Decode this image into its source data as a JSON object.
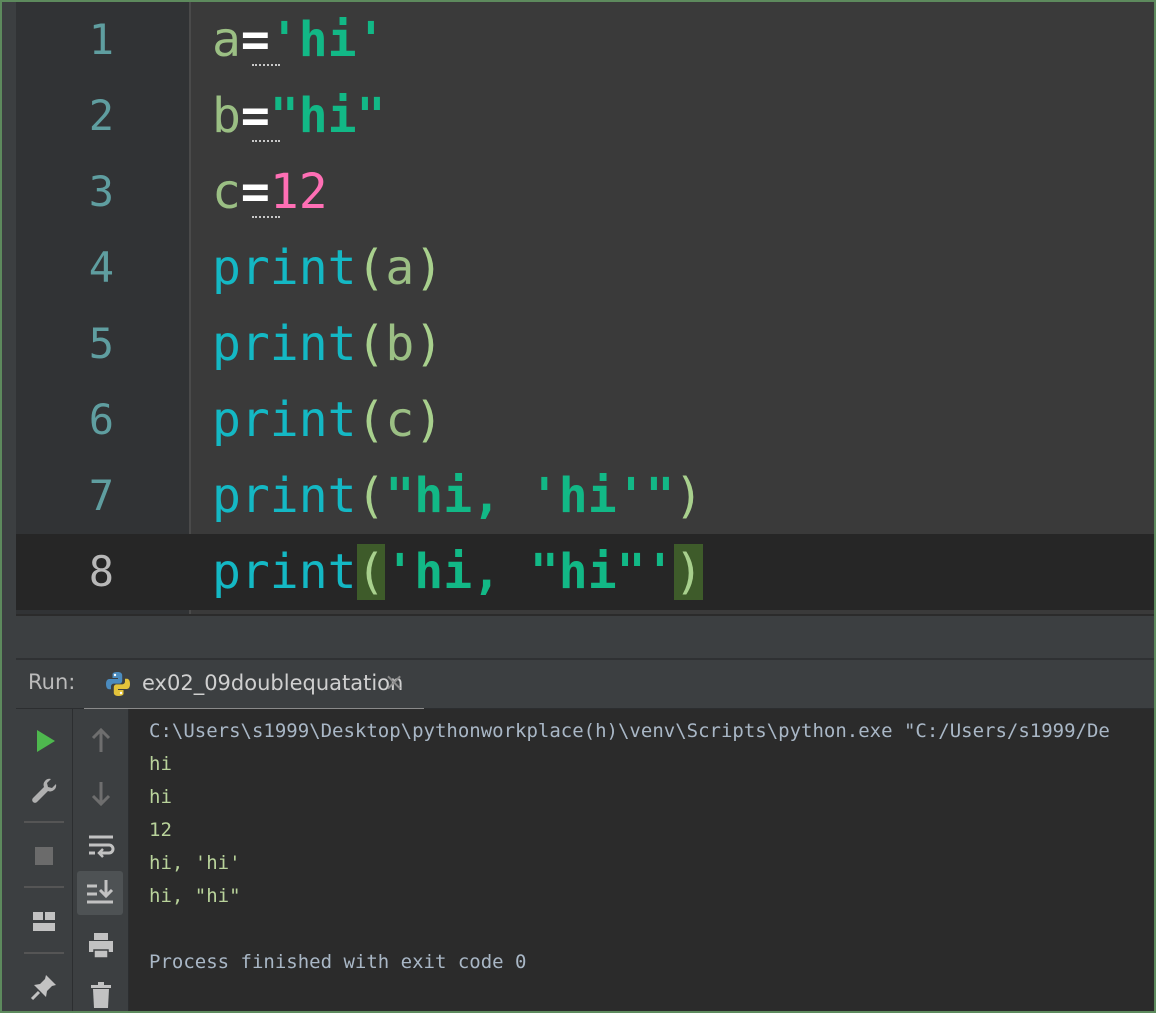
{
  "editor": {
    "lines": [
      {
        "num": "1",
        "var": "a",
        "eq": "=",
        "val": "'hi'",
        "val_type": "str"
      },
      {
        "num": "2",
        "var": "b",
        "eq": "=",
        "val": "\"hi\"",
        "val_type": "str"
      },
      {
        "num": "3",
        "var": "c",
        "eq": "=",
        "val": "12",
        "val_type": "num"
      },
      {
        "num": "4",
        "fn": "print",
        "open": "(",
        "arg": "a",
        "close": ")"
      },
      {
        "num": "5",
        "fn": "print",
        "open": "(",
        "arg": "b",
        "close": ")"
      },
      {
        "num": "6",
        "fn": "print",
        "open": "(",
        "arg": "c",
        "close": ")"
      },
      {
        "num": "7",
        "fn": "print",
        "open": "(",
        "arg": "\"hi, 'hi'\"",
        "close": ")"
      },
      {
        "num": "8",
        "fn": "print",
        "open": "(",
        "arg": "'hi, \"hi\"'",
        "close": ")"
      }
    ],
    "current_line": "8"
  },
  "run_panel": {
    "label": "Run:",
    "tab_title": "ex02_09doublequatation",
    "tab_close": "×",
    "left_toolbar": [
      "run-icon",
      "wrench-icon",
      "stop-icon",
      "layout-icon",
      "pin-icon"
    ],
    "right_toolbar": [
      "arrow-up-icon",
      "arrow-down-icon",
      "soft-wrap-icon",
      "scroll-to-end-icon",
      "print-icon",
      "trash-icon"
    ]
  },
  "console": {
    "command": "C:\\Users\\s1999\\Desktop\\pythonworkplace(h)\\venv\\Scripts\\python.exe \"C:/Users/s1999/De",
    "output": [
      "hi",
      "hi",
      "12",
      "hi, 'hi'",
      "hi, \"hi\"",
      ""
    ],
    "exit_message": "Process finished with exit code 0"
  },
  "colors": {
    "editor_bg": "#3a3a3a",
    "current_line_bg": "#262626",
    "string": "#12b886",
    "number": "#ff6fb5",
    "function": "#14b8c4",
    "variable": "#9bbf84",
    "brace_highlight": "#3e5b2a",
    "console_output": "#b9d39b",
    "frame_border": "#5d8a5d"
  }
}
